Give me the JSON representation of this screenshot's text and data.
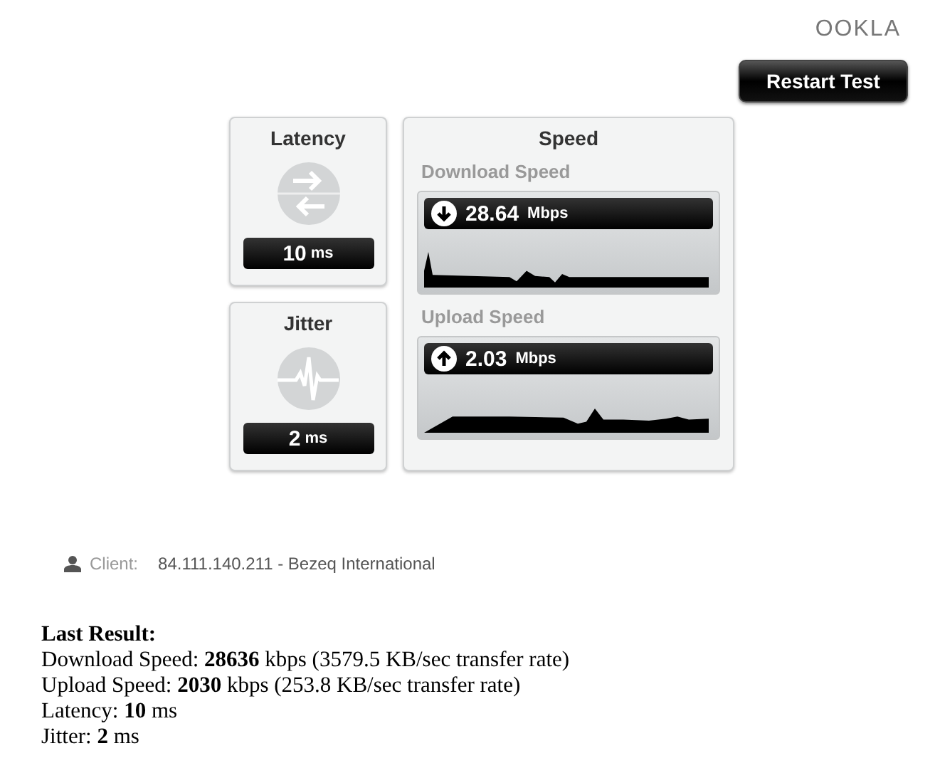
{
  "logo": "OOKLA",
  "restart_button": "Restart Test",
  "latency": {
    "title": "Latency",
    "value": "10",
    "unit": "ms"
  },
  "jitter": {
    "title": "Jitter",
    "value": "2",
    "unit": "ms"
  },
  "speed": {
    "title": "Speed",
    "sections": [
      {
        "kind": "download",
        "label": "Download Speed",
        "value": "28.64",
        "unit": "Mbps"
      },
      {
        "kind": "upload",
        "label": "Upload Speed",
        "value": "2.03",
        "unit": "Mbps"
      }
    ]
  },
  "client": {
    "label": "Client:",
    "value": "84.111.140.211 - Bezeq International"
  },
  "last_result": {
    "heading": "Last Result:",
    "lines": [
      "Download Speed: **28636** kbps (3579.5 KB/sec transfer rate)",
      "Upload Speed: **2030** kbps (253.8 KB/sec transfer rate)",
      "Latency: **10** ms",
      "Jitter: **2** ms"
    ]
  }
}
